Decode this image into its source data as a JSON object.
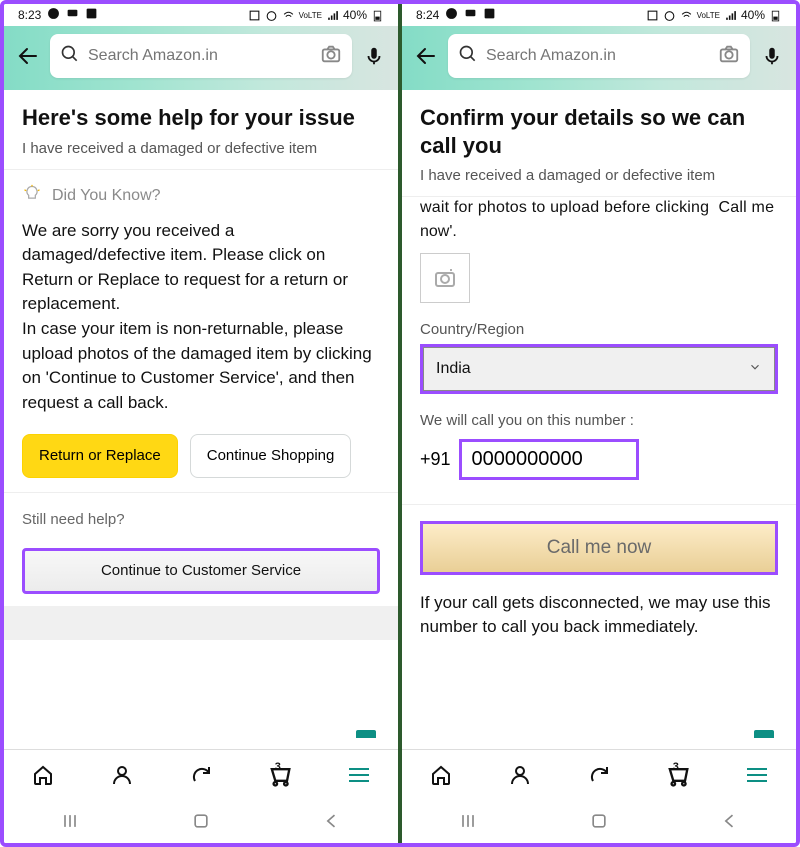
{
  "screen1": {
    "status": {
      "time": "8:23",
      "battery": "40%"
    },
    "search_placeholder": "Search Amazon.in",
    "page_title": "Here's some help for your issue",
    "subtitle": "I have received a damaged or defective item",
    "dyk_label": "Did You Know?",
    "body_text": "We are sorry you received a damaged/defective item. Please click on Return or Replace to request for a return or replacement.\nIn case your item is non-returnable, please upload photos of the damaged item by clicking on 'Continue to Customer Service', and then request a call back.",
    "btn_return": "Return or Replace",
    "btn_continue_shopping": "Continue Shopping",
    "still_need_help": "Still need help?",
    "btn_continue_cs": "Continue to Customer Service",
    "cart_count": "3"
  },
  "screen2": {
    "status": {
      "time": "8:24",
      "battery": "40%"
    },
    "search_placeholder": "Search Amazon.in",
    "page_title": "Confirm your details so we can call you",
    "subtitle": "I have received a damaged or defective item",
    "truncated_text": "now'.",
    "country_label": "Country/Region",
    "country_value": "India",
    "phone_label": "We will call you on this number :",
    "country_code": "+91",
    "phone_value": "0000000000",
    "btn_call": "Call me now",
    "disconnect_text": "If your call gets disconnected, we may use this number to call you back immediately.",
    "cart_count": "3"
  }
}
